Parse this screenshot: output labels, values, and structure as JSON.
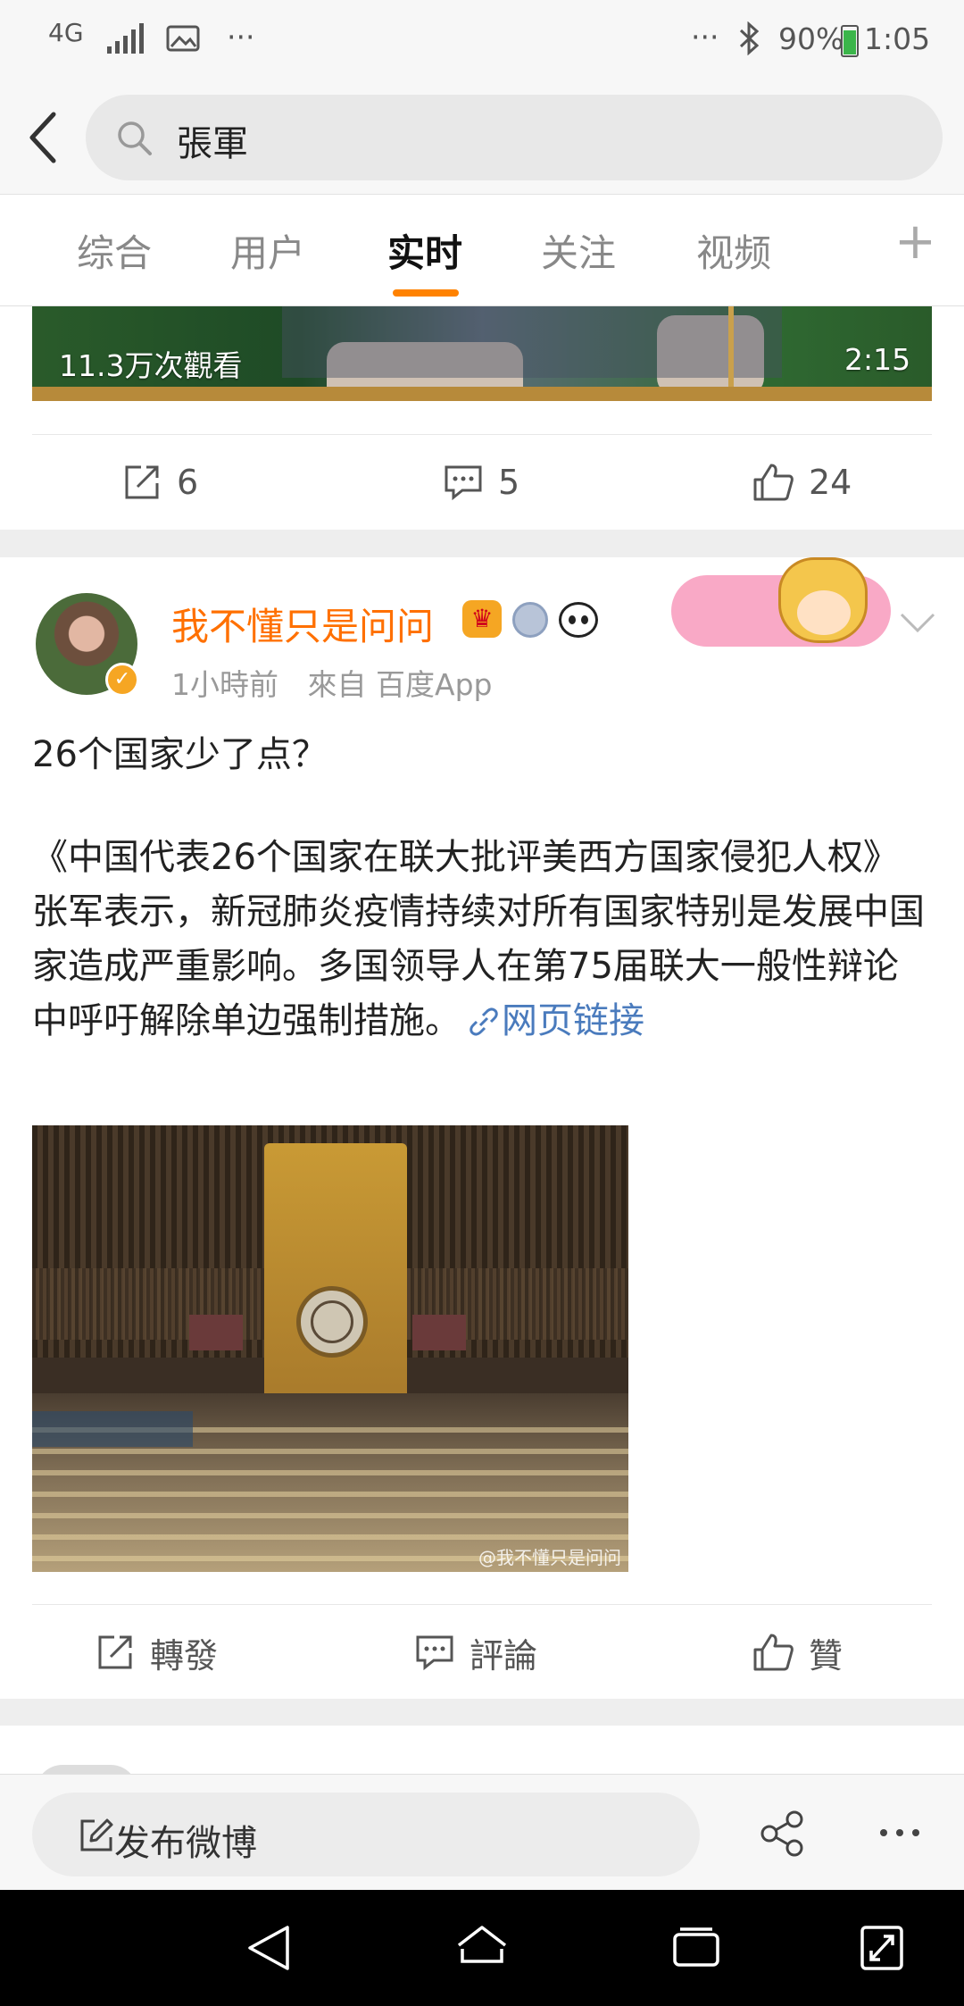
{
  "status_bar": {
    "network": "4G",
    "icons_left": [
      "signal-icon",
      "gallery-icon"
    ],
    "more_left": "···",
    "more_right": "···",
    "battery_percent": "90%",
    "time": "1:05"
  },
  "search": {
    "query": "張軍"
  },
  "tabs": [
    {
      "label": "综合",
      "active": false
    },
    {
      "label": "用户",
      "active": false
    },
    {
      "label": "实时",
      "active": true
    },
    {
      "label": "关注",
      "active": false
    },
    {
      "label": "视频",
      "active": false
    }
  ],
  "tab_add": "+",
  "prev_post": {
    "video_views": "11.3万次觀看",
    "video_duration": "2:15",
    "reposts": "6",
    "comments": "5",
    "likes": "24"
  },
  "post": {
    "username": "我不懂只是问问",
    "time": "1小時前",
    "source": "來自 百度App",
    "line1": "26个国家少了点？",
    "body": "《中国代表26个国家在联大批评美西方国家侵犯人权》张军表示，新冠肺炎疫情持续对所有国家特别是发展中国家造成严重影响。多国领导人在第75届联大一般性辩论中呼吁解除单边强制措施。",
    "link_label": "网页链接",
    "image_watermark": "@我不懂只是问问",
    "actions": {
      "repost": "轉發",
      "comment": "評論",
      "like": "贊"
    }
  },
  "compose": {
    "label": "发布微博"
  },
  "colors": {
    "accent": "#ff8200",
    "username": "#ff7000",
    "link": "#4a7bbd"
  }
}
